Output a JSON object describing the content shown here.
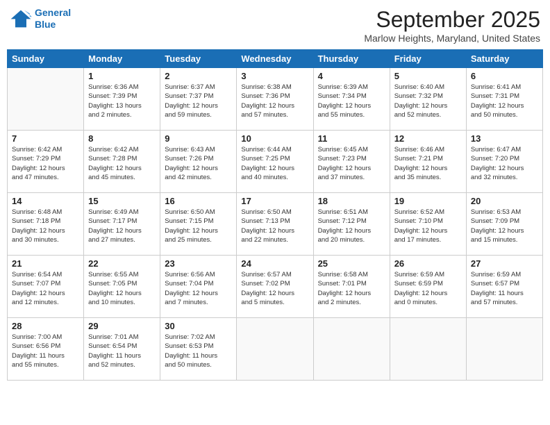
{
  "header": {
    "logo": {
      "line1": "General",
      "line2": "Blue"
    },
    "title": "September 2025",
    "location": "Marlow Heights, Maryland, United States"
  },
  "days_of_week": [
    "Sunday",
    "Monday",
    "Tuesday",
    "Wednesday",
    "Thursday",
    "Friday",
    "Saturday"
  ],
  "weeks": [
    [
      {
        "day": "",
        "info": ""
      },
      {
        "day": "1",
        "info": "Sunrise: 6:36 AM\nSunset: 7:39 PM\nDaylight: 13 hours\nand 2 minutes."
      },
      {
        "day": "2",
        "info": "Sunrise: 6:37 AM\nSunset: 7:37 PM\nDaylight: 12 hours\nand 59 minutes."
      },
      {
        "day": "3",
        "info": "Sunrise: 6:38 AM\nSunset: 7:36 PM\nDaylight: 12 hours\nand 57 minutes."
      },
      {
        "day": "4",
        "info": "Sunrise: 6:39 AM\nSunset: 7:34 PM\nDaylight: 12 hours\nand 55 minutes."
      },
      {
        "day": "5",
        "info": "Sunrise: 6:40 AM\nSunset: 7:32 PM\nDaylight: 12 hours\nand 52 minutes."
      },
      {
        "day": "6",
        "info": "Sunrise: 6:41 AM\nSunset: 7:31 PM\nDaylight: 12 hours\nand 50 minutes."
      }
    ],
    [
      {
        "day": "7",
        "info": "Sunrise: 6:42 AM\nSunset: 7:29 PM\nDaylight: 12 hours\nand 47 minutes."
      },
      {
        "day": "8",
        "info": "Sunrise: 6:42 AM\nSunset: 7:28 PM\nDaylight: 12 hours\nand 45 minutes."
      },
      {
        "day": "9",
        "info": "Sunrise: 6:43 AM\nSunset: 7:26 PM\nDaylight: 12 hours\nand 42 minutes."
      },
      {
        "day": "10",
        "info": "Sunrise: 6:44 AM\nSunset: 7:25 PM\nDaylight: 12 hours\nand 40 minutes."
      },
      {
        "day": "11",
        "info": "Sunrise: 6:45 AM\nSunset: 7:23 PM\nDaylight: 12 hours\nand 37 minutes."
      },
      {
        "day": "12",
        "info": "Sunrise: 6:46 AM\nSunset: 7:21 PM\nDaylight: 12 hours\nand 35 minutes."
      },
      {
        "day": "13",
        "info": "Sunrise: 6:47 AM\nSunset: 7:20 PM\nDaylight: 12 hours\nand 32 minutes."
      }
    ],
    [
      {
        "day": "14",
        "info": "Sunrise: 6:48 AM\nSunset: 7:18 PM\nDaylight: 12 hours\nand 30 minutes."
      },
      {
        "day": "15",
        "info": "Sunrise: 6:49 AM\nSunset: 7:17 PM\nDaylight: 12 hours\nand 27 minutes."
      },
      {
        "day": "16",
        "info": "Sunrise: 6:50 AM\nSunset: 7:15 PM\nDaylight: 12 hours\nand 25 minutes."
      },
      {
        "day": "17",
        "info": "Sunrise: 6:50 AM\nSunset: 7:13 PM\nDaylight: 12 hours\nand 22 minutes."
      },
      {
        "day": "18",
        "info": "Sunrise: 6:51 AM\nSunset: 7:12 PM\nDaylight: 12 hours\nand 20 minutes."
      },
      {
        "day": "19",
        "info": "Sunrise: 6:52 AM\nSunset: 7:10 PM\nDaylight: 12 hours\nand 17 minutes."
      },
      {
        "day": "20",
        "info": "Sunrise: 6:53 AM\nSunset: 7:09 PM\nDaylight: 12 hours\nand 15 minutes."
      }
    ],
    [
      {
        "day": "21",
        "info": "Sunrise: 6:54 AM\nSunset: 7:07 PM\nDaylight: 12 hours\nand 12 minutes."
      },
      {
        "day": "22",
        "info": "Sunrise: 6:55 AM\nSunset: 7:05 PM\nDaylight: 12 hours\nand 10 minutes."
      },
      {
        "day": "23",
        "info": "Sunrise: 6:56 AM\nSunset: 7:04 PM\nDaylight: 12 hours\nand 7 minutes."
      },
      {
        "day": "24",
        "info": "Sunrise: 6:57 AM\nSunset: 7:02 PM\nDaylight: 12 hours\nand 5 minutes."
      },
      {
        "day": "25",
        "info": "Sunrise: 6:58 AM\nSunset: 7:01 PM\nDaylight: 12 hours\nand 2 minutes."
      },
      {
        "day": "26",
        "info": "Sunrise: 6:59 AM\nSunset: 6:59 PM\nDaylight: 12 hours\nand 0 minutes."
      },
      {
        "day": "27",
        "info": "Sunrise: 6:59 AM\nSunset: 6:57 PM\nDaylight: 11 hours\nand 57 minutes."
      }
    ],
    [
      {
        "day": "28",
        "info": "Sunrise: 7:00 AM\nSunset: 6:56 PM\nDaylight: 11 hours\nand 55 minutes."
      },
      {
        "day": "29",
        "info": "Sunrise: 7:01 AM\nSunset: 6:54 PM\nDaylight: 11 hours\nand 52 minutes."
      },
      {
        "day": "30",
        "info": "Sunrise: 7:02 AM\nSunset: 6:53 PM\nDaylight: 11 hours\nand 50 minutes."
      },
      {
        "day": "",
        "info": ""
      },
      {
        "day": "",
        "info": ""
      },
      {
        "day": "",
        "info": ""
      },
      {
        "day": "",
        "info": ""
      }
    ]
  ]
}
